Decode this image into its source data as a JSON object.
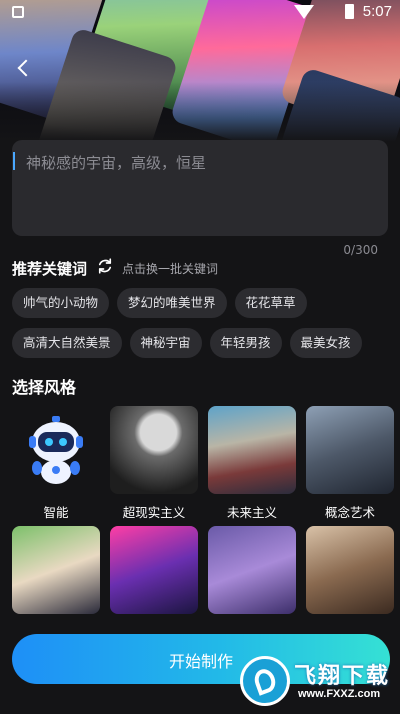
{
  "status_bar": {
    "time": "5:07"
  },
  "prompt": {
    "placeholder": "神秘感的宇宙，高级，恒星",
    "value": "",
    "counter": "0/300"
  },
  "keywords": {
    "title": "推荐关键词",
    "refresh_hint": "点击换一批关键词",
    "rows": [
      [
        "帅气的小动物",
        "梦幻的唯美世界",
        "花花草草"
      ],
      [
        "高清大自然美景",
        "神秘宇宙",
        "年轻男孩",
        "最美女孩"
      ]
    ]
  },
  "styles": {
    "title": "选择风格",
    "items": [
      {
        "label": "智能",
        "icon": "robot-icon"
      },
      {
        "label": "超现实主义"
      },
      {
        "label": "未来主义"
      },
      {
        "label": "概念艺术"
      },
      {
        "label": ""
      },
      {
        "label": ""
      },
      {
        "label": ""
      },
      {
        "label": ""
      }
    ]
  },
  "start_button": {
    "label": "开始制作"
  },
  "watermark": {
    "name": "飞翔下载",
    "url": "www.FXXZ.com"
  },
  "colors": {
    "accent": "#1e8ff7",
    "background": "#141416",
    "chip": "#2c2c30"
  }
}
